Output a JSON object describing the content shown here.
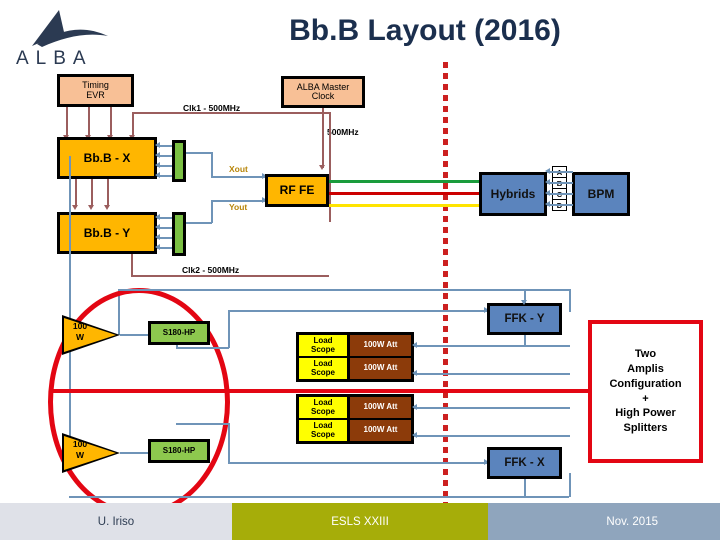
{
  "slide": {
    "title": "Bb.B Layout (2016)",
    "logo_text": "ALBA"
  },
  "blocks": {
    "timing_evr": "Timing\nEVR",
    "timing_evr_line1": "Timing",
    "timing_evr_line2": "EVR",
    "alba_master_clock_line1": "ALBA Master",
    "alba_master_clock_line2": "Clock",
    "bbb_x": "Bb.B - X",
    "bbb_y": "Bb.B - Y",
    "rf_fe": "RF FE",
    "hybrids": "Hybrids",
    "bpm": "BPM",
    "ffk_y": "FFK - Y",
    "ffk_x": "FFK - X",
    "splitter_top": "S180-HP",
    "splitter_bottom": "S180-HP",
    "amp_top_line1": "100",
    "amp_top_line2": "W",
    "amp_bottom_line1": "100",
    "amp_bottom_line2": "W",
    "load_scope": "Load\nScope",
    "load_scope_l1": "Load",
    "load_scope_l2": "Scope",
    "att": "100W Att"
  },
  "load_rows": [
    {
      "load_l1": "Load",
      "load_l2": "Scope",
      "att": "100W Att"
    },
    {
      "load_l1": "Load",
      "load_l2": "Scope",
      "att": "100W Att"
    },
    {
      "load_l1": "Load",
      "load_l2": "Scope",
      "att": "100W Att"
    },
    {
      "load_l1": "Load",
      "load_l2": "Scope",
      "att": "100W Att"
    }
  ],
  "labels": {
    "clk1": "Clk1 - 500MHz",
    "clk2": "Clk2 - 500MHz",
    "freq_500": "500MHz",
    "xout": "Xout",
    "yout": "Yout"
  },
  "bpm_ports": [
    "A",
    "B",
    "C",
    "D"
  ],
  "note": {
    "line1": "Two",
    "line2": "Amplis",
    "line3": "Configuration",
    "line4": "+",
    "line5": "High Power",
    "line6": "Splitters",
    "full": "Two Amplis Configuration + High Power Splitters"
  },
  "footer": {
    "author": "U. Iriso",
    "conference": "ESLS XXIII",
    "date": "Nov. 2015"
  },
  "colors": {
    "title": "#1b2f4e",
    "peach_block": "#f8c096",
    "orange_block": "#ffb600",
    "blue_block": "#5b84bd",
    "green_block": "#7bc043",
    "yellow_block": "#ffff00",
    "brown_block": "#8c3b0a",
    "accent_red": "#e30613",
    "wire_blue": "#6f94b8",
    "wire_brown": "#9b5e5e",
    "signal_green": "#1a9c3c",
    "signal_red": "#cc0000",
    "signal_yellow": "#ffe400",
    "footer_gray": "#dfe1e8",
    "footer_olive": "#a6ad09",
    "footer_blue": "#8fa5bd"
  }
}
